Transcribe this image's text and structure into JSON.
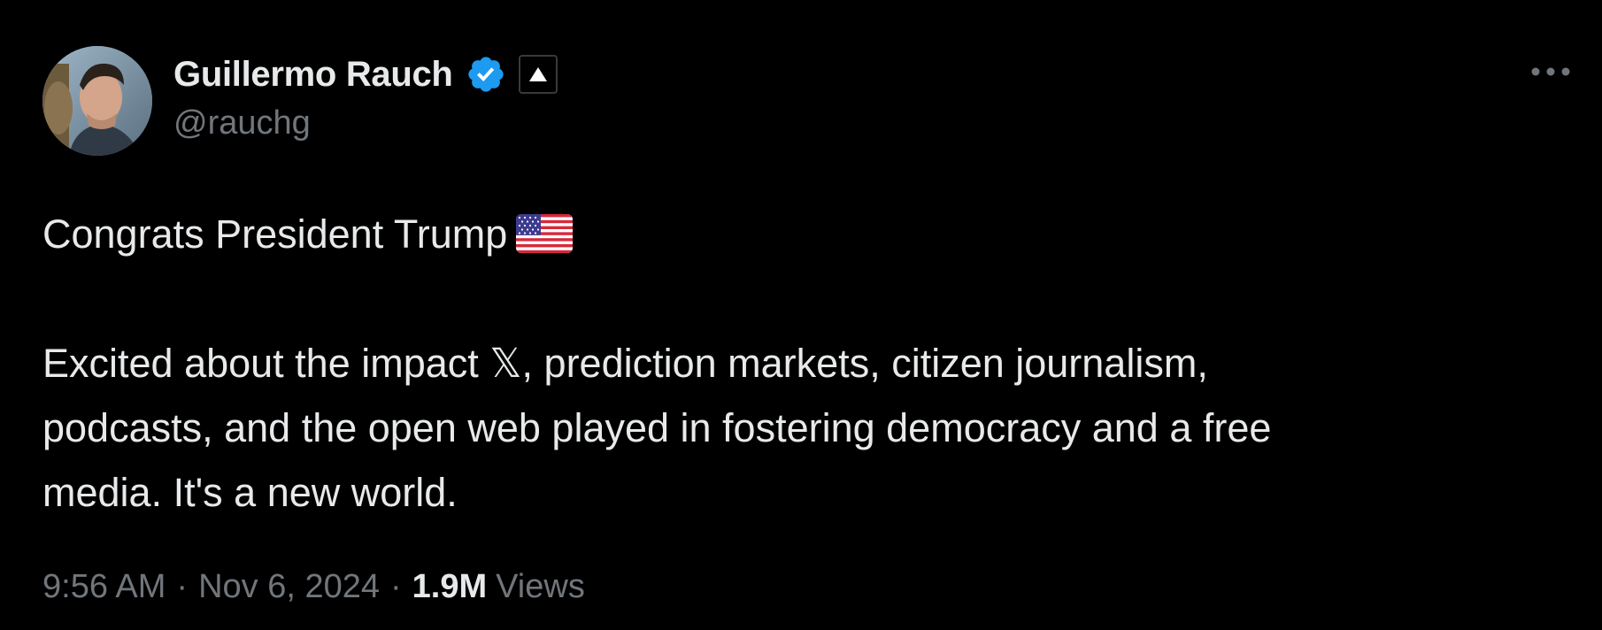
{
  "author": {
    "display_name": "Guillermo Rauch",
    "handle": "@rauchg",
    "avatar_icon": "avatar",
    "verified_icon": "verified-badge-icon",
    "affiliate_icon": "vercel-triangle-icon",
    "verified_color": "#1d9bf0"
  },
  "tweet": {
    "lines": [
      "Congrats President Trump",
      "",
      "Excited about the impact 𝕏, prediction markets, citizen journalism,",
      "podcasts, and the open web played in fostering democracy and a free",
      "media. It's a new world."
    ],
    "flag_icon": "us-flag-icon"
  },
  "meta": {
    "time": "9:56 AM",
    "separator": "·",
    "date": "Nov 6, 2024",
    "views_count": "1.9M",
    "views_label": "Views"
  },
  "more_icon": "more-dots-icon",
  "colors": {
    "background": "#000000",
    "primary_text": "#e7e9ea",
    "secondary_text": "#71767b"
  }
}
